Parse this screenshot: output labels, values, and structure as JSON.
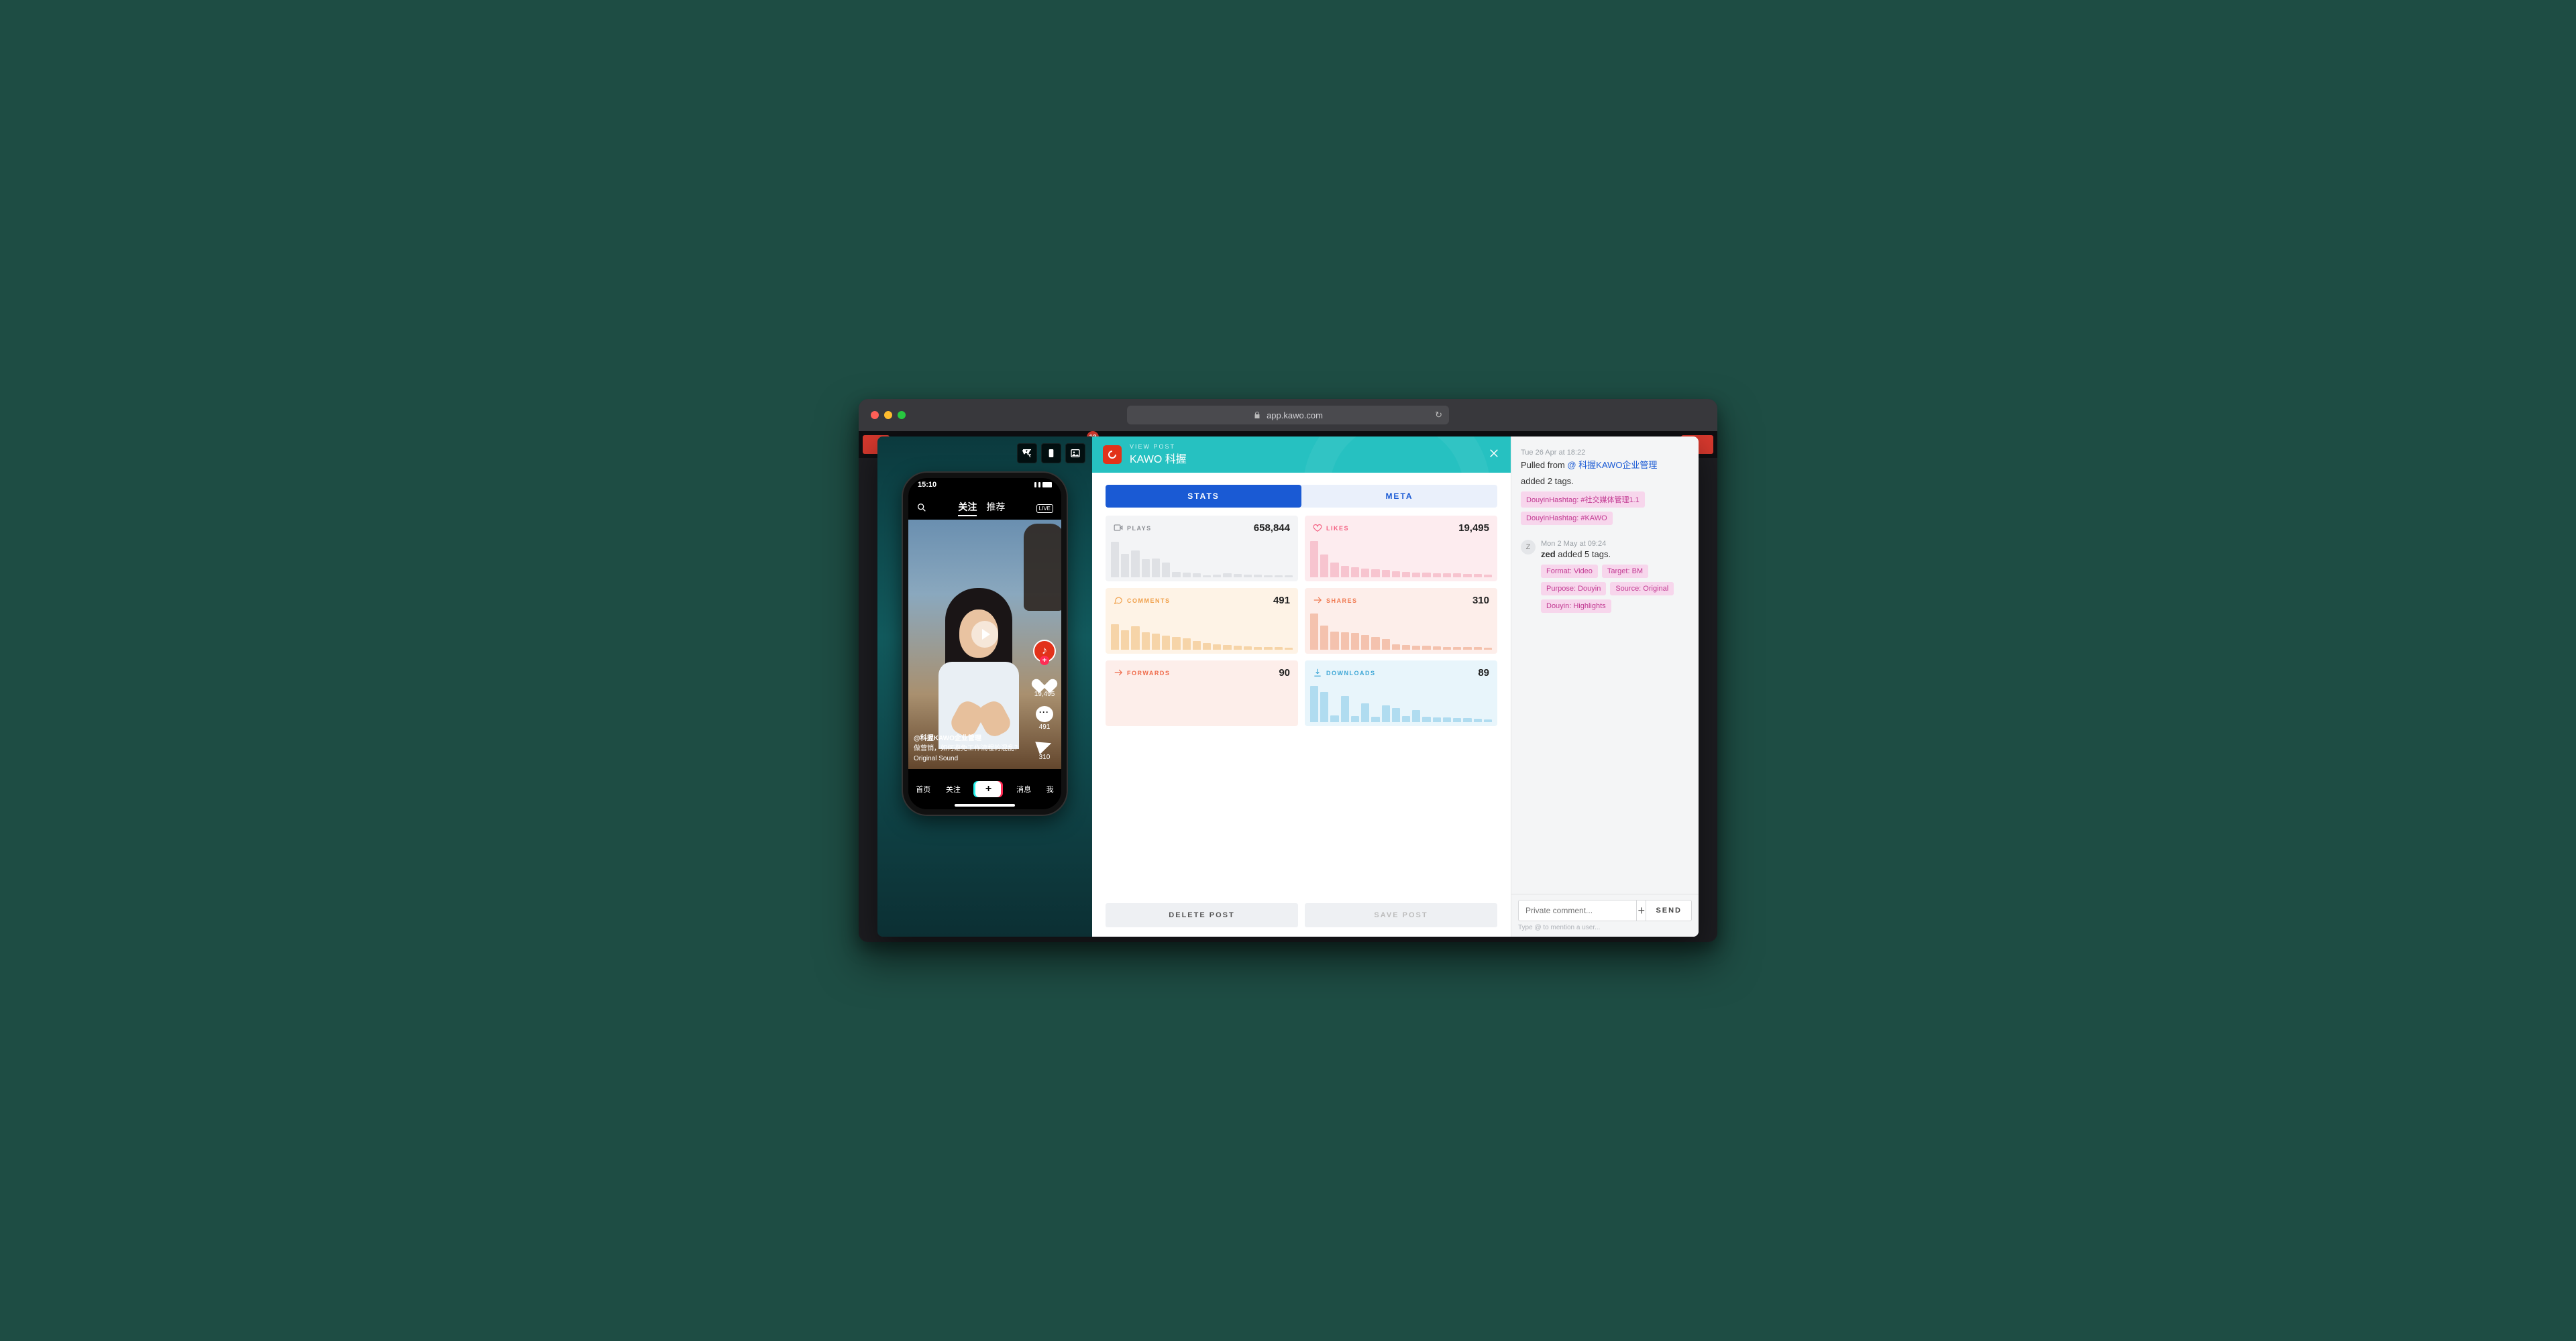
{
  "browser": {
    "url": "app.kawo.com",
    "notification_count": "13"
  },
  "header": {
    "sub": "VIEW POST",
    "title": "KAWO 科握"
  },
  "tabs": {
    "stats": "STATS",
    "meta": "META"
  },
  "stats": {
    "plays": {
      "label": "PLAYS",
      "value": "658,844",
      "bars": [
        95,
        62,
        72,
        48,
        50,
        40,
        14,
        12,
        10,
        6,
        8,
        10,
        9,
        8,
        7,
        6,
        6,
        5
      ]
    },
    "likes": {
      "label": "LIKES",
      "value": "19,495",
      "bars": [
        96,
        60,
        40,
        30,
        26,
        24,
        22,
        20,
        16,
        14,
        12,
        12,
        11,
        10,
        10,
        9,
        9,
        8
      ]
    },
    "comments": {
      "label": "COMMENTS",
      "value": "491",
      "bars": [
        68,
        52,
        62,
        46,
        42,
        38,
        34,
        30,
        24,
        18,
        14,
        12,
        10,
        9,
        8,
        8,
        7,
        6
      ]
    },
    "shares": {
      "label": "SHARES",
      "value": "310",
      "bars": [
        96,
        64,
        48,
        46,
        44,
        40,
        34,
        28,
        14,
        12,
        10,
        10,
        9,
        8,
        8,
        7,
        7,
        6
      ]
    },
    "forwards": {
      "label": "FORWARDS",
      "value": "90",
      "bars": [
        0,
        0,
        0,
        0,
        0,
        0,
        0,
        0,
        0,
        0,
        0,
        0,
        0,
        0,
        0,
        0,
        0,
        0
      ]
    },
    "downloads": {
      "label": "DOWNLOADS",
      "value": "89",
      "bars": [
        96,
        80,
        18,
        70,
        16,
        50,
        14,
        44,
        38,
        16,
        32,
        14,
        12,
        12,
        10,
        10,
        9,
        8
      ]
    }
  },
  "actions": {
    "delete": "DELETE POST",
    "save": "SAVE POST"
  },
  "phone": {
    "time": "15:10",
    "tabs": {
      "follow": "关注",
      "recommend": "推荐"
    },
    "likes": "19,495",
    "comments": "491",
    "shares": "310",
    "author": "@科握KAWO企业管理",
    "caption": "做营销，如何避免工作流程的混乱？",
    "sound": "Original Sound",
    "nav": {
      "home": "首页",
      "follow": "关注",
      "inbox": "消息",
      "me": "我"
    }
  },
  "activity": [
    {
      "time": "Tue 26 Apr at 18:22",
      "title_prefix": "Pulled from ",
      "title_link": "@ 科握KAWO企业管理",
      "sub": "added 2 tags.",
      "tags": [
        "DouyinHashtag: #社交媒体管理1.1",
        "DouyinHashtag: #KAWO"
      ]
    },
    {
      "time": "Mon 2 May at 09:24",
      "avatar": "Z",
      "title_html": "zed added 5 tags.",
      "tags": [
        "Format: Video",
        "Target: BM",
        "Purpose: Douyin",
        "Source: Original",
        "Douyin: Highlights"
      ]
    }
  ],
  "comment": {
    "placeholder": "Private comment...",
    "send": "SEND",
    "hint": "Type @ to mention a user..."
  }
}
